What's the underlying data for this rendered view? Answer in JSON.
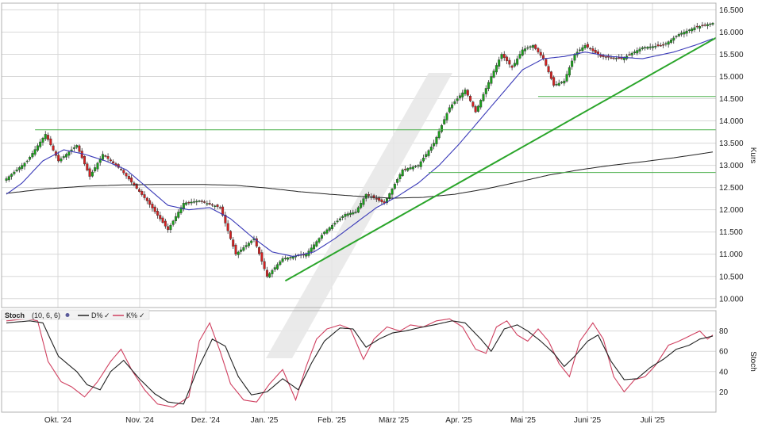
{
  "colors": {
    "up_candle": "#1aa11a",
    "down_candle": "#d42020",
    "sma_short": "#3a3ab8",
    "sma_long": "#222222",
    "trendline": "#2aa52a",
    "support": "#4cb04c",
    "stoch_d": "#222222",
    "stoch_k": "#d04060",
    "grid": "#d8d8d8",
    "watermark": "#e6e6e6"
  },
  "chart_data": [
    {
      "type": "candlestick",
      "ylabel": "Kurs",
      "ylim": [
        9800,
        16650
      ],
      "yticks": [
        10000,
        10500,
        11000,
        11500,
        12000,
        12500,
        13000,
        13500,
        14000,
        14500,
        15000,
        15500,
        16000,
        16500
      ],
      "ytick_labels": [
        "10.000",
        "10.500",
        "11.000",
        "11.500",
        "12.000",
        "12.500",
        "13.000",
        "13.500",
        "14.000",
        "14.500",
        "15.000",
        "15.500",
        "16.000",
        "16.500"
      ],
      "x_months": [
        "Okt. '24",
        "Nov. '24",
        "Dez. '24",
        "Jan. '25",
        "Feb. '25",
        "März '25",
        "Apr. '25",
        "Mai '25",
        "Juni '25",
        "Juli '25"
      ],
      "price_keypoints": [
        [
          0,
          12700
        ],
        [
          8,
          13100
        ],
        [
          15,
          13700
        ],
        [
          20,
          13100
        ],
        [
          27,
          13450
        ],
        [
          32,
          12750
        ],
        [
          37,
          13250
        ],
        [
          44,
          12900
        ],
        [
          54,
          12200
        ],
        [
          62,
          11550
        ],
        [
          68,
          12150
        ],
        [
          74,
          12200
        ],
        [
          82,
          12050
        ],
        [
          88,
          11000
        ],
        [
          95,
          11350
        ],
        [
          100,
          10500
        ],
        [
          106,
          10900
        ],
        [
          115,
          11000
        ],
        [
          122,
          11500
        ],
        [
          130,
          11900
        ],
        [
          134,
          11950
        ],
        [
          138,
          12350
        ],
        [
          145,
          12150
        ],
        [
          152,
          12900
        ],
        [
          158,
          13000
        ],
        [
          164,
          13500
        ],
        [
          170,
          14300
        ],
        [
          176,
          14700
        ],
        [
          180,
          14200
        ],
        [
          186,
          15000
        ],
        [
          190,
          15500
        ],
        [
          194,
          15200
        ],
        [
          198,
          15600
        ],
        [
          202,
          15700
        ],
        [
          206,
          15400
        ],
        [
          210,
          14800
        ],
        [
          214,
          14900
        ],
        [
          218,
          15500
        ],
        [
          222,
          15700
        ],
        [
          228,
          15450
        ],
        [
          236,
          15400
        ],
        [
          244,
          15650
        ],
        [
          252,
          15700
        ],
        [
          258,
          15950
        ],
        [
          264,
          16100
        ],
        [
          271,
          16200
        ]
      ],
      "sma_short_keypoints": [
        [
          0,
          12350
        ],
        [
          6,
          12600
        ],
        [
          14,
          13100
        ],
        [
          22,
          13350
        ],
        [
          30,
          13250
        ],
        [
          38,
          13100
        ],
        [
          46,
          12900
        ],
        [
          54,
          12500
        ],
        [
          62,
          12100
        ],
        [
          70,
          12000
        ],
        [
          78,
          12050
        ],
        [
          86,
          11800
        ],
        [
          94,
          11400
        ],
        [
          102,
          11050
        ],
        [
          110,
          10950
        ],
        [
          118,
          11050
        ],
        [
          126,
          11350
        ],
        [
          134,
          11700
        ],
        [
          142,
          12050
        ],
        [
          150,
          12300
        ],
        [
          158,
          12600
        ],
        [
          166,
          13000
        ],
        [
          174,
          13500
        ],
        [
          182,
          14050
        ],
        [
          190,
          14600
        ],
        [
          198,
          15150
        ],
        [
          206,
          15400
        ],
        [
          214,
          15450
        ],
        [
          222,
          15550
        ],
        [
          232,
          15450
        ],
        [
          244,
          15400
        ],
        [
          256,
          15550
        ],
        [
          264,
          15700
        ],
        [
          271,
          15850
        ]
      ],
      "sma_long_keypoints": [
        [
          0,
          12370
        ],
        [
          15,
          12470
        ],
        [
          30,
          12530
        ],
        [
          45,
          12560
        ],
        [
          60,
          12570
        ],
        [
          75,
          12570
        ],
        [
          88,
          12550
        ],
        [
          100,
          12490
        ],
        [
          112,
          12410
        ],
        [
          124,
          12350
        ],
        [
          136,
          12300
        ],
        [
          148,
          12260
        ],
        [
          160,
          12280
        ],
        [
          172,
          12350
        ],
        [
          184,
          12470
        ],
        [
          196,
          12620
        ],
        [
          208,
          12780
        ],
        [
          220,
          12900
        ],
        [
          232,
          13000
        ],
        [
          244,
          13080
        ],
        [
          256,
          13170
        ],
        [
          271,
          13300
        ]
      ],
      "support_levels": [
        {
          "value": 13800,
          "x_from": 11
        },
        {
          "value": 14550,
          "x_from": 204
        },
        {
          "value": 12840,
          "x_from": 162
        }
      ],
      "trendline": {
        "from": [
          107,
          10400
        ],
        "to": [
          275,
          15870
        ]
      }
    },
    {
      "type": "line",
      "title": "Stoch",
      "params": "(10, 6, 6)",
      "ylabel": "Stoch",
      "ylim": [
        0,
        100
      ],
      "yticks": [
        20,
        40,
        60,
        80
      ],
      "ytick_labels": [
        "20",
        "40",
        "60",
        "80"
      ],
      "series": [
        {
          "name": "D%",
          "keypoints": [
            [
              0,
              88
            ],
            [
              9,
              90
            ],
            [
              14,
              88
            ],
            [
              20,
              55
            ],
            [
              27,
              40
            ],
            [
              31,
              27
            ],
            [
              36,
              22
            ],
            [
              40,
              40
            ],
            [
              45,
              51
            ],
            [
              51,
              33
            ],
            [
              57,
              18
            ],
            [
              62,
              10
            ],
            [
              68,
              8
            ],
            [
              73,
              40
            ],
            [
              79,
              72
            ],
            [
              84,
              65
            ],
            [
              89,
              35
            ],
            [
              94,
              17
            ],
            [
              100,
              20
            ],
            [
              106,
              33
            ],
            [
              112,
              22
            ],
            [
              117,
              48
            ],
            [
              122,
              70
            ],
            [
              128,
              83
            ],
            [
              133,
              82
            ],
            [
              138,
              64
            ],
            [
              143,
              72
            ],
            [
              148,
              78
            ],
            [
              153,
              80
            ],
            [
              158,
              83
            ],
            [
              164,
              86
            ],
            [
              171,
              90
            ],
            [
              176,
              88
            ],
            [
              182,
              72
            ],
            [
              186,
              60
            ],
            [
              191,
              82
            ],
            [
              196,
              86
            ],
            [
              200,
              80
            ],
            [
              205,
              70
            ],
            [
              210,
              58
            ],
            [
              214,
              45
            ],
            [
              218,
              55
            ],
            [
              223,
              70
            ],
            [
              227,
              76
            ],
            [
              232,
              50
            ],
            [
              237,
              32
            ],
            [
              242,
              33
            ],
            [
              247,
              44
            ],
            [
              252,
              52
            ],
            [
              257,
              62
            ],
            [
              262,
              66
            ],
            [
              266,
              72
            ],
            [
              271,
              75
            ]
          ]
        },
        {
          "name": "K%",
          "keypoints": [
            [
              0,
              90
            ],
            [
              8,
              92
            ],
            [
              12,
              90
            ],
            [
              16,
              50
            ],
            [
              21,
              30
            ],
            [
              25,
              25
            ],
            [
              30,
              15
            ],
            [
              35,
              30
            ],
            [
              40,
              50
            ],
            [
              44,
              62
            ],
            [
              48,
              42
            ],
            [
              53,
              22
            ],
            [
              58,
              8
            ],
            [
              64,
              5
            ],
            [
              70,
              15
            ],
            [
              74,
              70
            ],
            [
              78,
              88
            ],
            [
              82,
              60
            ],
            [
              86,
              28
            ],
            [
              91,
              12
            ],
            [
              96,
              10
            ],
            [
              101,
              28
            ],
            [
              106,
              42
            ],
            [
              111,
              12
            ],
            [
              115,
              45
            ],
            [
              119,
              72
            ],
            [
              123,
              82
            ],
            [
              128,
              86
            ],
            [
              132,
              82
            ],
            [
              137,
              52
            ],
            [
              141,
              72
            ],
            [
              146,
              84
            ],
            [
              151,
              80
            ],
            [
              155,
              86
            ],
            [
              160,
              84
            ],
            [
              165,
              90
            ],
            [
              170,
              92
            ],
            [
              175,
              84
            ],
            [
              180,
              62
            ],
            [
              184,
              58
            ],
            [
              188,
              84
            ],
            [
              192,
              90
            ],
            [
              196,
              76
            ],
            [
              200,
              70
            ],
            [
              204,
              82
            ],
            [
              208,
              70
            ],
            [
              212,
              48
            ],
            [
              216,
              35
            ],
            [
              220,
              70
            ],
            [
              225,
              88
            ],
            [
              229,
              72
            ],
            [
              233,
              35
            ],
            [
              237,
              20
            ],
            [
              241,
              32
            ],
            [
              245,
              35
            ],
            [
              249,
              46
            ],
            [
              254,
              66
            ],
            [
              258,
              70
            ],
            [
              262,
              75
            ],
            [
              266,
              80
            ],
            [
              269,
              72
            ],
            [
              272,
              78
            ]
          ]
        }
      ]
    }
  ]
}
